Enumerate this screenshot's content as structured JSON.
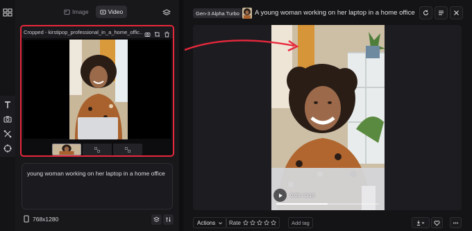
{
  "icons": {
    "sidebar_toggle": "sidebar-toggle-icon",
    "text_tool": "text-tool-icon",
    "camera_tool": "camera-tool-icon",
    "motion_tool": "motion-tool-icon",
    "target_tool": "target-tool-icon"
  },
  "mode_toggle": {
    "image_label": "Image",
    "video_label": "Video",
    "active": "Video"
  },
  "media": {
    "title": "Cropped - kirstipop_professional_in_a_home_offic..."
  },
  "prompt": {
    "text": "young woman working on her laptop in a home office",
    "aspect": "768x1280"
  },
  "result": {
    "model": "Gen-3 Alpha Turbo",
    "title": "A young woman working on her laptop in a home office",
    "time": "0:05 / 0:10",
    "progress": 0.5
  },
  "bottom_bar": {
    "actions_label": "Actions",
    "rate_label": "Rate",
    "stars": 5,
    "add_tag_label": "Add tag"
  },
  "colors": {
    "highlight": "#e8283c",
    "background": "#141416",
    "panel": "#18181b"
  }
}
